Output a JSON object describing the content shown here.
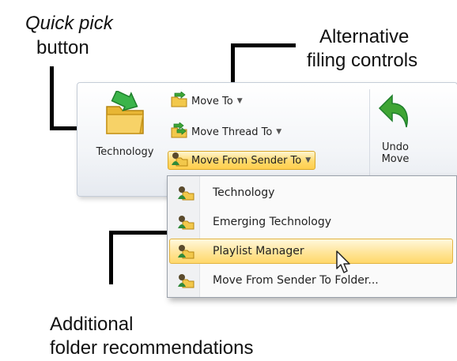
{
  "annotations": {
    "quick_pick": {
      "line1": "Quick pick",
      "line2": "button"
    },
    "alternative": {
      "line1": "Alternative",
      "line2": "filing controls"
    },
    "additional": {
      "line1": "Additional",
      "line2": "folder recommendations"
    }
  },
  "ribbon": {
    "quick_pick_label": "Technology",
    "move_to_label": "Move To",
    "move_thread_label": "Move Thread To",
    "move_sender_label": "Move From Sender To",
    "undo_line1": "Undo",
    "undo_line2": "Move"
  },
  "menu": {
    "items": [
      {
        "label": "Technology"
      },
      {
        "label": "Emerging Technology"
      },
      {
        "label": "Playlist Manager"
      },
      {
        "label": "Move From Sender To Folder..."
      }
    ]
  },
  "icons": {
    "folder": "folder-arrow-icon",
    "sender": "sender-folder-icon",
    "undo": "undo-arrow-icon",
    "cursor": "mouse-pointer-icon"
  },
  "colors": {
    "highlight": "#ffd96b",
    "folder": "#f2c84b",
    "arrow": "#3fa534"
  }
}
